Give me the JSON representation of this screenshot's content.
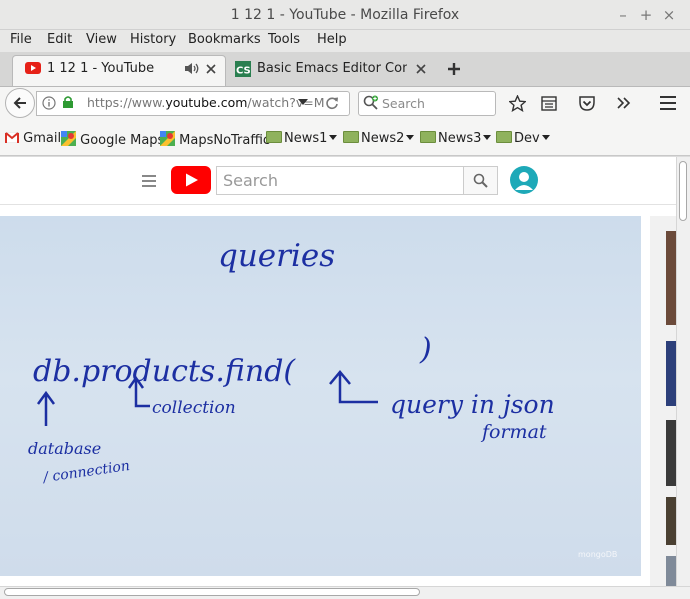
{
  "window": {
    "title": "1 12 1 - YouTube - Mozilla Firefox",
    "controls": [
      "–",
      "+",
      "×"
    ]
  },
  "menu": [
    "File",
    "Edit",
    "View",
    "History",
    "Bookmarks",
    "Tools",
    "Help"
  ],
  "tabs": [
    {
      "label": "1 12 1 - YouTube",
      "active": true
    },
    {
      "label": "Basic Emacs Editor Com...",
      "active": false
    }
  ],
  "navbar": {
    "url_prefix": "https://www.",
    "url_host": "youtube.com",
    "url_rest": "/watch?v=M",
    "search_placeholder": "Search"
  },
  "bookmarks": [
    {
      "label": "Gmail",
      "icon": "gmail-icon"
    },
    {
      "label": "Google Maps",
      "icon": "maps-icon"
    },
    {
      "label": "MapsNoTraffic",
      "icon": "maps-icon"
    },
    {
      "label": "News1",
      "icon": "folder-icon"
    },
    {
      "label": "News2",
      "icon": "folder-icon"
    },
    {
      "label": "News3",
      "icon": "folder-icon"
    },
    {
      "label": "Dev",
      "icon": "folder-icon"
    }
  ],
  "youtube": {
    "search_placeholder": "Search"
  },
  "video": {
    "handwriting": {
      "heading": "queries",
      "code": "db.products.find(",
      "paren_close": ")",
      "label_database": "database",
      "label_connection": "/ connection",
      "label_collection": "collection",
      "label_query": "query in json",
      "label_format": "format"
    },
    "watermark": "mongoDB"
  },
  "colors": {
    "youtube_red": "#ff0000",
    "ink": "#1c2fa2",
    "firefox_ui": "#f5f5f4"
  }
}
